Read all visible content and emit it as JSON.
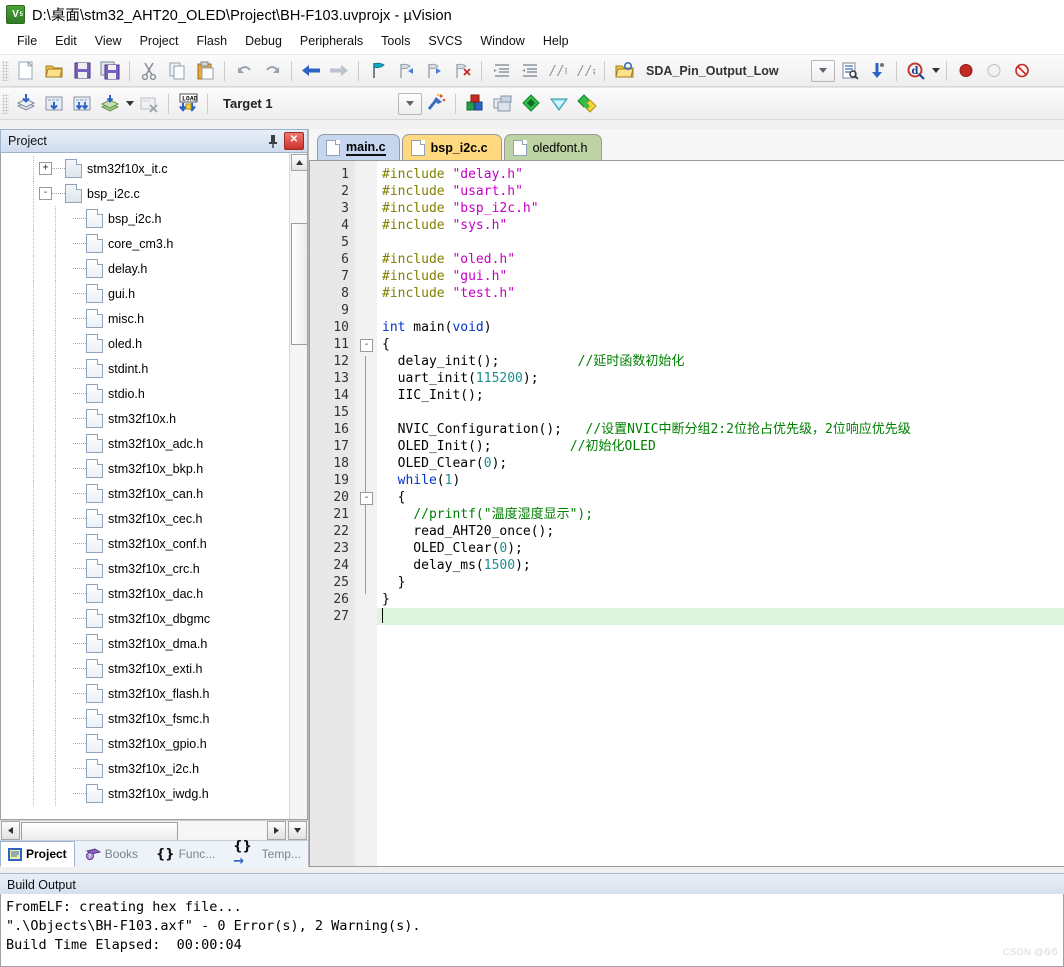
{
  "window": {
    "title": "D:\\桌面\\stm32_AHT20_OLED\\Project\\BH-F103.uvprojx - µVision",
    "app_icon_label": "V",
    "app_icon_sub": "5"
  },
  "menu": {
    "items": [
      "File",
      "Edit",
      "View",
      "Project",
      "Flash",
      "Debug",
      "Peripherals",
      "Tools",
      "SVCS",
      "Window",
      "Help"
    ]
  },
  "toolbar": {
    "row1": [
      {
        "name": "new-file-icon",
        "tip": "New"
      },
      {
        "name": "open-file-icon",
        "tip": "Open"
      },
      {
        "name": "save-icon",
        "tip": "Save"
      },
      {
        "name": "save-all-icon",
        "tip": "Save All"
      },
      {
        "name": "cut-icon",
        "tip": "Cut"
      },
      {
        "name": "copy-icon",
        "tip": "Copy"
      },
      {
        "name": "paste-icon",
        "tip": "Paste"
      },
      {
        "name": "undo-icon",
        "tip": "Undo"
      },
      {
        "name": "redo-icon",
        "tip": "Redo"
      },
      {
        "name": "navigate-back-icon",
        "tip": "Back"
      },
      {
        "name": "navigate-forward-icon",
        "tip": "Forward"
      },
      {
        "name": "bookmark-toggle-icon",
        "tip": "Insert/Remove Bookmark"
      },
      {
        "name": "bookmark-prev-icon",
        "tip": "Previous Bookmark"
      },
      {
        "name": "bookmark-next-icon",
        "tip": "Next Bookmark"
      },
      {
        "name": "bookmark-clear-icon",
        "tip": "Clear All Bookmarks"
      },
      {
        "name": "indent-icon",
        "tip": "Indent"
      },
      {
        "name": "outdent-icon",
        "tip": "Outdent"
      },
      {
        "name": "comment-icon",
        "tip": "Comment"
      },
      {
        "name": "uncomment-icon",
        "tip": "Uncomment"
      }
    ],
    "find_value": "SDA_Pin_Output_Low",
    "find_placeholder": "",
    "row2": [
      {
        "name": "translate-icon",
        "tip": "Translate"
      },
      {
        "name": "build-icon",
        "tip": "Build"
      },
      {
        "name": "rebuild-icon",
        "tip": "Rebuild"
      },
      {
        "name": "batch-build-icon",
        "tip": "Batch Build"
      },
      {
        "name": "stop-build-icon",
        "tip": "Stop Build"
      },
      {
        "name": "download-icon",
        "tip": "Download"
      }
    ],
    "target_value": "Target 1",
    "target_options": [
      "Target 1"
    ],
    "after_target": [
      {
        "name": "target-options-icon",
        "tip": "Options for Target"
      },
      {
        "name": "manage-components-icon",
        "tip": "Manage Project Items"
      },
      {
        "name": "manage-layers-icon",
        "tip": "Manage Layers"
      },
      {
        "name": "pack-installer-icon",
        "tip": "Pack Installer"
      },
      {
        "name": "configuration-wizard-icon",
        "tip": "Configuration Wizard"
      },
      {
        "name": "multi-project-icon",
        "tip": "Multi-Project"
      }
    ]
  },
  "project_panel": {
    "title": "Project",
    "pin_icon": "pin-icon",
    "close_icon": "close-icon",
    "tree": [
      {
        "label": "stm32f10x_it.c",
        "indent": 2,
        "expander": "+",
        "kind": "c"
      },
      {
        "label": "bsp_i2c.c",
        "indent": 2,
        "expander": "-",
        "kind": "c"
      },
      {
        "label": "bsp_i2c.h",
        "indent": 3,
        "expander": "",
        "kind": "h"
      },
      {
        "label": "core_cm3.h",
        "indent": 3,
        "expander": "",
        "kind": "h"
      },
      {
        "label": "delay.h",
        "indent": 3,
        "expander": "",
        "kind": "h"
      },
      {
        "label": "gui.h",
        "indent": 3,
        "expander": "",
        "kind": "h"
      },
      {
        "label": "misc.h",
        "indent": 3,
        "expander": "",
        "kind": "h"
      },
      {
        "label": "oled.h",
        "indent": 3,
        "expander": "",
        "kind": "h"
      },
      {
        "label": "stdint.h",
        "indent": 3,
        "expander": "",
        "kind": "h"
      },
      {
        "label": "stdio.h",
        "indent": 3,
        "expander": "",
        "kind": "h"
      },
      {
        "label": "stm32f10x.h",
        "indent": 3,
        "expander": "",
        "kind": "h"
      },
      {
        "label": "stm32f10x_adc.h",
        "indent": 3,
        "expander": "",
        "kind": "h"
      },
      {
        "label": "stm32f10x_bkp.h",
        "indent": 3,
        "expander": "",
        "kind": "h"
      },
      {
        "label": "stm32f10x_can.h",
        "indent": 3,
        "expander": "",
        "kind": "h"
      },
      {
        "label": "stm32f10x_cec.h",
        "indent": 3,
        "expander": "",
        "kind": "h"
      },
      {
        "label": "stm32f10x_conf.h",
        "indent": 3,
        "expander": "",
        "kind": "h"
      },
      {
        "label": "stm32f10x_crc.h",
        "indent": 3,
        "expander": "",
        "kind": "h"
      },
      {
        "label": "stm32f10x_dac.h",
        "indent": 3,
        "expander": "",
        "kind": "h"
      },
      {
        "label": "stm32f10x_dbgmc",
        "indent": 3,
        "expander": "",
        "kind": "h"
      },
      {
        "label": "stm32f10x_dma.h",
        "indent": 3,
        "expander": "",
        "kind": "h"
      },
      {
        "label": "stm32f10x_exti.h",
        "indent": 3,
        "expander": "",
        "kind": "h"
      },
      {
        "label": "stm32f10x_flash.h",
        "indent": 3,
        "expander": "",
        "kind": "h"
      },
      {
        "label": "stm32f10x_fsmc.h",
        "indent": 3,
        "expander": "",
        "kind": "h"
      },
      {
        "label": "stm32f10x_gpio.h",
        "indent": 3,
        "expander": "",
        "kind": "h"
      },
      {
        "label": "stm32f10x_i2c.h",
        "indent": 3,
        "expander": "",
        "kind": "h"
      },
      {
        "label": "stm32f10x_iwdg.h",
        "indent": 3,
        "expander": "",
        "kind": "h"
      }
    ],
    "tabs": [
      {
        "label": "Project",
        "icon": "project-icon",
        "active": true
      },
      {
        "label": "Books",
        "icon": "books-icon",
        "active": false
      },
      {
        "label": "Func...",
        "icon": "functions-icon",
        "active": false
      },
      {
        "label": "Temp...",
        "icon": "templates-icon",
        "active": false
      }
    ]
  },
  "editor": {
    "tabs": [
      {
        "label": "main.c",
        "state": "active"
      },
      {
        "label": "bsp_i2c.c",
        "state": "amber"
      },
      {
        "label": "oledfont.h",
        "state": "green"
      }
    ],
    "current_line": 27,
    "lines": [
      {
        "n": 1,
        "tokens": [
          {
            "t": "#include ",
            "c": "pp"
          },
          {
            "t": "\"delay.h\"",
            "c": "str"
          }
        ]
      },
      {
        "n": 2,
        "tokens": [
          {
            "t": "#include ",
            "c": "pp"
          },
          {
            "t": "\"usart.h\"",
            "c": "str"
          }
        ]
      },
      {
        "n": 3,
        "tokens": [
          {
            "t": "#include ",
            "c": "pp"
          },
          {
            "t": "\"bsp_i2c.h\"",
            "c": "str"
          }
        ]
      },
      {
        "n": 4,
        "tokens": [
          {
            "t": "#include ",
            "c": "pp"
          },
          {
            "t": "\"sys.h\"",
            "c": "str"
          }
        ]
      },
      {
        "n": 5,
        "tokens": []
      },
      {
        "n": 6,
        "tokens": [
          {
            "t": "#include ",
            "c": "pp"
          },
          {
            "t": "\"oled.h\"",
            "c": "str"
          }
        ]
      },
      {
        "n": 7,
        "tokens": [
          {
            "t": "#include ",
            "c": "pp"
          },
          {
            "t": "\"gui.h\"",
            "c": "str"
          }
        ]
      },
      {
        "n": 8,
        "tokens": [
          {
            "t": "#include ",
            "c": "pp"
          },
          {
            "t": "\"test.h\"",
            "c": "str"
          }
        ]
      },
      {
        "n": 9,
        "tokens": []
      },
      {
        "n": 10,
        "tokens": [
          {
            "t": "int",
            "c": "kw"
          },
          {
            "t": " main(",
            "c": ""
          },
          {
            "t": "void",
            "c": "kw"
          },
          {
            "t": ")",
            "c": ""
          }
        ]
      },
      {
        "n": 11,
        "tokens": [
          {
            "t": "{",
            "c": ""
          }
        ]
      },
      {
        "n": 12,
        "tokens": [
          {
            "t": "  delay_init();",
            "c": ""
          },
          {
            "t": "          ",
            "c": ""
          },
          {
            "t": "//延时函数初始化",
            "c": "cm"
          }
        ]
      },
      {
        "n": 13,
        "tokens": [
          {
            "t": "  uart_init(",
            "c": ""
          },
          {
            "t": "115200",
            "c": "num"
          },
          {
            "t": ");",
            "c": ""
          }
        ]
      },
      {
        "n": 14,
        "tokens": [
          {
            "t": "  IIC_Init();",
            "c": ""
          }
        ]
      },
      {
        "n": 15,
        "tokens": []
      },
      {
        "n": 16,
        "tokens": [
          {
            "t": "  NVIC_Configuration();",
            "c": ""
          },
          {
            "t": "   ",
            "c": ""
          },
          {
            "t": "//设置NVIC中断分组2:2位抢占优先级，2位响应优先级",
            "c": "cm"
          }
        ]
      },
      {
        "n": 17,
        "tokens": [
          {
            "t": "  OLED_Init();",
            "c": ""
          },
          {
            "t": "          ",
            "c": ""
          },
          {
            "t": "//初始化OLED",
            "c": "cm"
          }
        ]
      },
      {
        "n": 18,
        "tokens": [
          {
            "t": "  OLED_Clear(",
            "c": ""
          },
          {
            "t": "0",
            "c": "num"
          },
          {
            "t": ");",
            "c": ""
          }
        ]
      },
      {
        "n": 19,
        "tokens": [
          {
            "t": "  ",
            "c": ""
          },
          {
            "t": "while",
            "c": "kw"
          },
          {
            "t": "(",
            "c": ""
          },
          {
            "t": "1",
            "c": "num"
          },
          {
            "t": ")",
            "c": ""
          }
        ]
      },
      {
        "n": 20,
        "tokens": [
          {
            "t": "  {",
            "c": ""
          }
        ]
      },
      {
        "n": 21,
        "tokens": [
          {
            "t": "    ",
            "c": ""
          },
          {
            "t": "//printf(\"温度湿度显示\");",
            "c": "cm"
          }
        ]
      },
      {
        "n": 22,
        "tokens": [
          {
            "t": "    read_AHT20_once();",
            "c": ""
          }
        ]
      },
      {
        "n": 23,
        "tokens": [
          {
            "t": "    OLED_Clear(",
            "c": ""
          },
          {
            "t": "0",
            "c": "num"
          },
          {
            "t": ");",
            "c": ""
          }
        ]
      },
      {
        "n": 24,
        "tokens": [
          {
            "t": "    delay_ms(",
            "c": ""
          },
          {
            "t": "1500",
            "c": "num"
          },
          {
            "t": ");",
            "c": ""
          }
        ]
      },
      {
        "n": 25,
        "tokens": [
          {
            "t": "  }",
            "c": ""
          }
        ]
      },
      {
        "n": 26,
        "tokens": [
          {
            "t": "}",
            "c": ""
          }
        ]
      },
      {
        "n": 27,
        "tokens": []
      }
    ]
  },
  "build_output": {
    "title": "Build Output",
    "lines": [
      "FromELF: creating hex file...",
      "\".\\Objects\\BH-F103.axf\" - 0 Error(s), 2 Warning(s).",
      "Build Time Elapsed:  00:00:04"
    ]
  },
  "watermark": "CSDN @б⁄б",
  "colors": {
    "accent": "#c5d6ee",
    "tab_amber": "#ffd97f",
    "tab_green": "#bed3a3",
    "keyword": "#0033cc",
    "preprocessor": "#808000",
    "string": "#c400c4",
    "number": "#1d8d8d",
    "comment": "#008000",
    "current_line": "#ddf5df"
  }
}
